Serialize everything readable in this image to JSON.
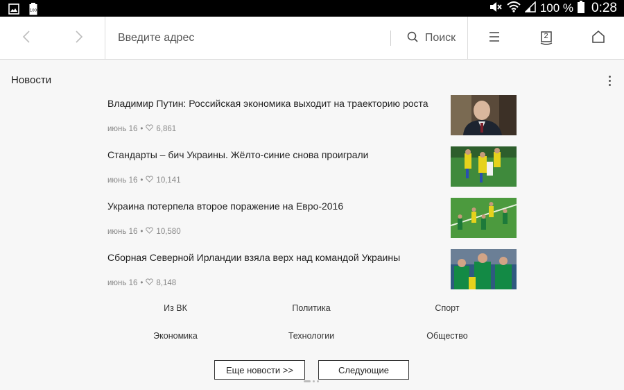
{
  "status": {
    "battery_percent": "100 %",
    "time": "0:28",
    "icons": [
      "gallery-icon",
      "battery-full-notif-icon",
      "mute-icon",
      "wifi-icon",
      "signal-icon",
      "battery-icon"
    ]
  },
  "toolbar": {
    "address_placeholder": "Введите адрес",
    "search_label": "Поиск",
    "tab_count": "2",
    "icons": [
      "chevron-left-icon",
      "chevron-right-icon",
      "search-icon",
      "menu-icon",
      "tabs-icon",
      "home-icon"
    ]
  },
  "news": {
    "section_title": "Новости",
    "items": [
      {
        "title": "Владимир Путин: Российская экономика выходит на траекторию роста",
        "date": "июнь 16",
        "likes": "6,861"
      },
      {
        "title": "Стандарты – бич Украины. Жёлто-синие снова проиграли",
        "date": "июнь 16",
        "likes": "10,141"
      },
      {
        "title": "Украина потерпела второе поражение на Евро-2016",
        "date": "июнь 16",
        "likes": "10,580"
      },
      {
        "title": "Сборная Северной Ирландии взяла верх над командой Украины",
        "date": "июнь 16",
        "likes": "8,148"
      }
    ],
    "categories": [
      [
        "Из ВК",
        "Политика",
        "Спорт"
      ],
      [
        "Экономика",
        "Технологии",
        "Общество"
      ]
    ],
    "more_button": "Еще новости >>",
    "next_button": "Следующие"
  },
  "colors": {
    "status_bar": "#000000",
    "toolbar_bg": "#ffffff",
    "page_bg": "#f7f7f7",
    "text_primary": "#222222",
    "text_meta": "#888888"
  }
}
